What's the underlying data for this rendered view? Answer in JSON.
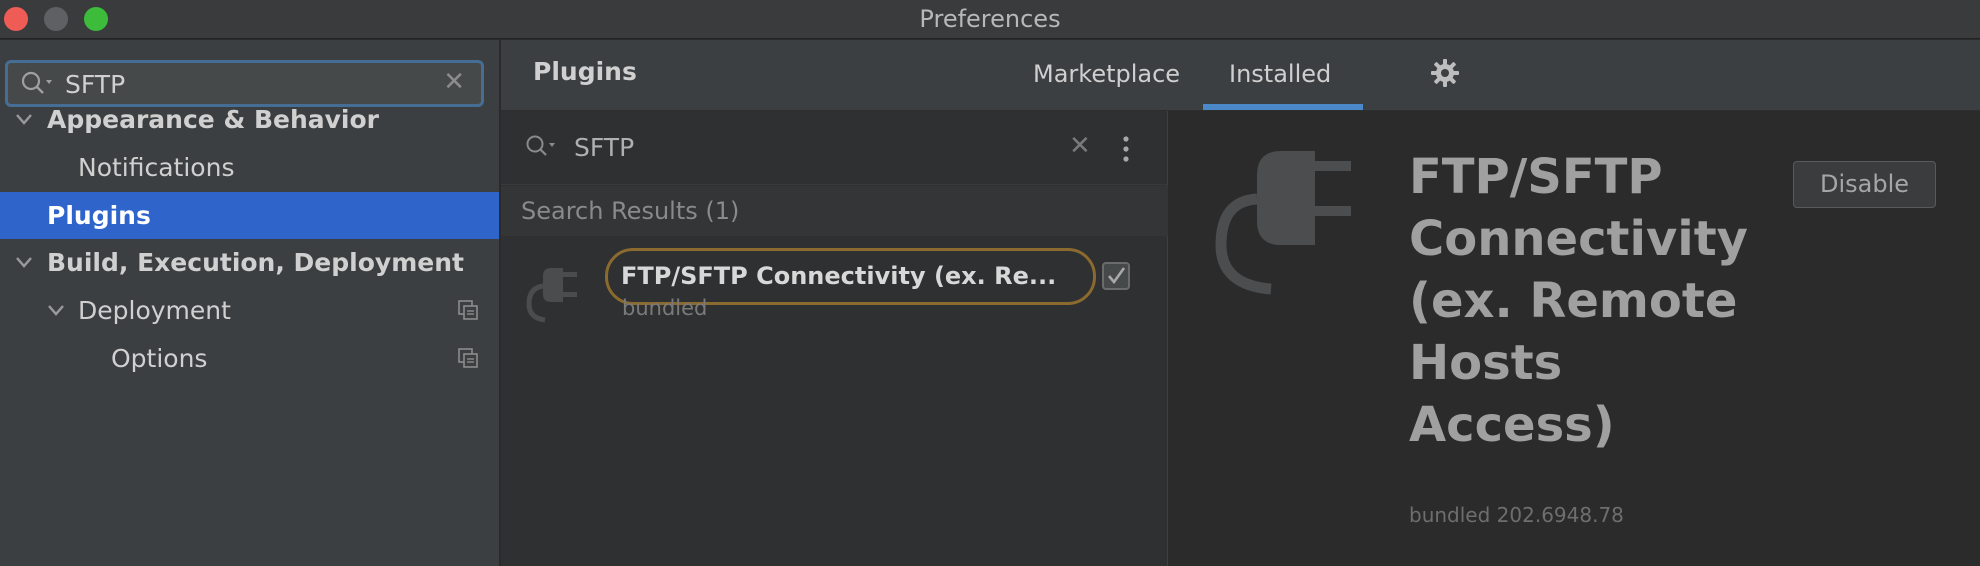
{
  "window": {
    "title": "Preferences"
  },
  "left_panel": {
    "search": {
      "value": "SFTP"
    },
    "tree": [
      {
        "label": "Appearance & Behavior"
      },
      {
        "label": "Notifications"
      },
      {
        "label": "Plugins"
      },
      {
        "label": "Build, Execution, Deployment"
      },
      {
        "label": "Deployment"
      },
      {
        "label": "Options"
      }
    ]
  },
  "plugins_header": {
    "title": "Plugins",
    "tabs": [
      {
        "label": "Marketplace"
      },
      {
        "label": "Installed"
      }
    ],
    "active_tab": "Installed"
  },
  "plugin_list": {
    "search_value": "SFTP",
    "results_label": "Search Results (1)",
    "items": [
      {
        "name": "FTP/SFTP Connectivity (ex. Re...",
        "subtitle": "bundled",
        "enabled": true
      }
    ]
  },
  "plugin_detail": {
    "name_lines": [
      "FTP/SFTP",
      "Connectivity",
      "(ex. Remote",
      "Hosts",
      "Access)"
    ],
    "disable_label": "Disable",
    "version": "bundled 202.6948.78"
  },
  "colors": {
    "selection": "#2f65ca",
    "accent": "#4a88c7",
    "highlight_ring": "#8a6a2e",
    "close": "#ee5c55",
    "maximize": "#3dbb3a"
  },
  "icons": [
    "search-icon",
    "clear-icon",
    "chevron-down-icon",
    "copy-icon",
    "gear-icon",
    "more-options-icon",
    "plugin-icon",
    "checkmark-icon"
  ]
}
